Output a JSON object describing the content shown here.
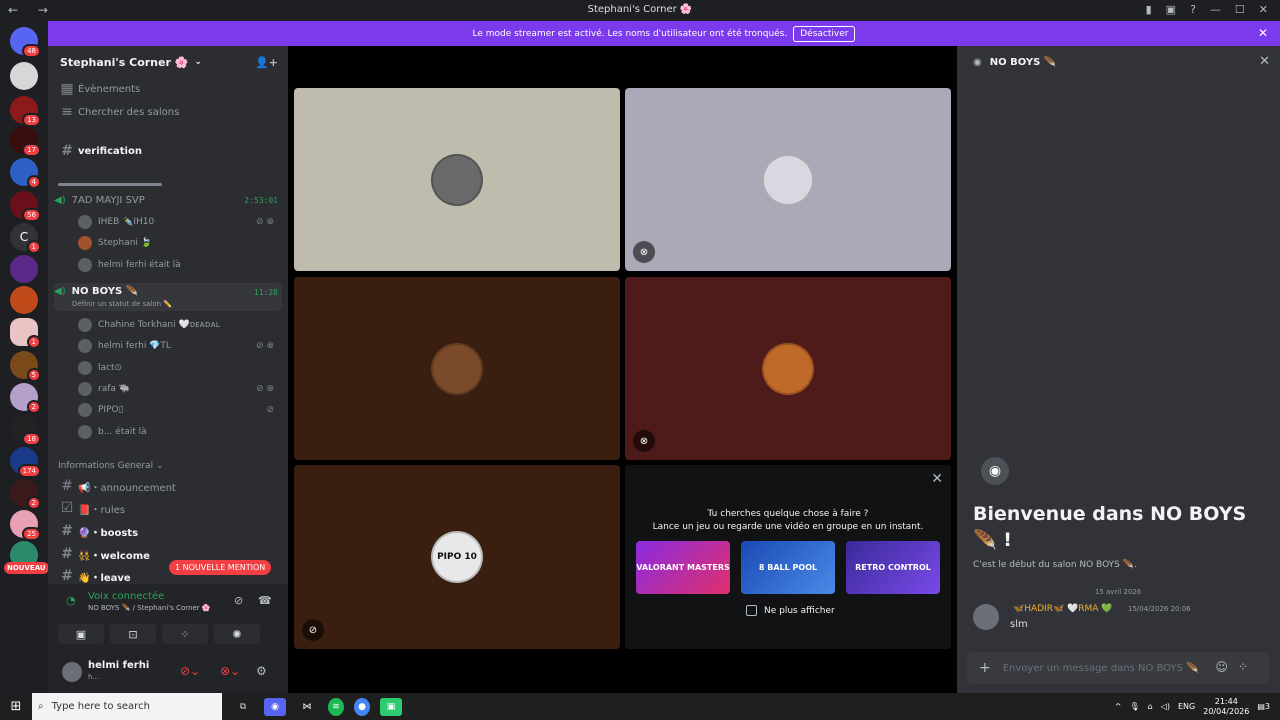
{
  "window": {
    "title": "Stephani's Corner 🌸",
    "nav": [
      "←",
      "→"
    ]
  },
  "banner": {
    "text": "Le mode streamer est activé. Les noms d'utilisateur ont été tronqués.",
    "button": "Désactiver"
  },
  "servers": {
    "badges": [
      "48",
      "13",
      "17",
      "4",
      "56",
      "1",
      "1",
      "5",
      "2",
      "18",
      "174",
      "2",
      "25"
    ],
    "new_label": "NOUVEAU",
    "letter": "C"
  },
  "guild": {
    "name": "Stephani's Corner 🌸",
    "events": "Évènements",
    "browse": "Chercher des salons",
    "verification": "verification",
    "voice1": {
      "name": "7AD MAYJI SVP",
      "time": "2:53:01",
      "members": [
        "IHEB ✒️IH10",
        "Stephani 🍃",
        "helmi ferhi était là"
      ]
    },
    "voice2": {
      "name": "NO BOYS 🪶",
      "status": "Définir un statut de salon ✏️",
      "time": "11:28",
      "members": [
        "Chahine Torkhani 🤍ᴅᴇᴀᴅᴀʟ",
        "helmi ferhi 💎TL",
        "lact⊙",
        "rafa 🐃",
        "PIPO▯",
        "b... était là"
      ]
    },
    "category": "Informations General",
    "text_channels": [
      "📢・announcement",
      "📕・rules",
      "🔮・boosts",
      "👯・welcome",
      "👋・leave"
    ],
    "mention": "1 NOUVELLE MENTION"
  },
  "voice_panel": {
    "status": "Voix connectée",
    "sub": "NO BOYS 🪶 / Stephani's Corner 🌸"
  },
  "user": {
    "name": "helmi ferhi",
    "status": "h..."
  },
  "activity": {
    "line1": "Tu cherches quelque chose à faire ?",
    "line2": "Lance un jeu ou regarde une vidéo en groupe en un instant.",
    "games": [
      "VALORANT MASTERS",
      "8 BALL POOL",
      "RETRO CONTROL"
    ],
    "dont_show": "Ne plus afficher"
  },
  "tiles": [
    {
      "label": "PIPO 10"
    }
  ],
  "chat": {
    "header": "NO BOYS 🪶",
    "welcome": "Bienvenue dans NO BOYS 🪶 !",
    "sub": "C'est le début du salon NO BOYS 🪶.",
    "date": "15 avril 2026",
    "author": "🦋HADIR🦋 🤍RMA 💚",
    "timestamp": "15/04/2026 20:06",
    "message": "slm",
    "placeholder": "Envoyer un message dans NO BOYS 🪶"
  },
  "taskbar": {
    "search": "Type here to search",
    "lang": "ENG",
    "time": "21:44",
    "date": "20/04/2026",
    "notif": "3"
  },
  "colors": {
    "banner": "#7c3aed",
    "online": "#23a55a",
    "danger": "#f23f43"
  }
}
